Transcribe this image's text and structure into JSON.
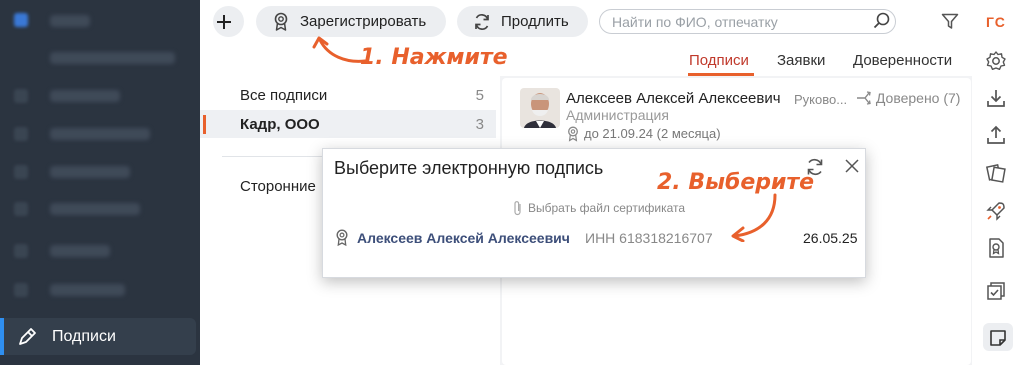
{
  "toolbar": {
    "register_label": "Зарегистрировать",
    "extend_label": "Продлить",
    "search_placeholder": "Найти по ФИО, отпечатку"
  },
  "rail": {
    "gc_label": "ГС"
  },
  "tabs": [
    {
      "label": "Подписи",
      "active": true
    },
    {
      "label": "Заявки",
      "active": false
    },
    {
      "label": "Доверенности",
      "active": false
    }
  ],
  "annotations": {
    "step1": "1. Нажмите",
    "step2": "2. Выберите",
    "color": "#e8602c"
  },
  "sidebar": {
    "active_label": "Подписи",
    "bg_color": "#2b3440"
  },
  "filter_list": {
    "items": [
      {
        "label": "Все подписи",
        "count": "5"
      },
      {
        "label": "Кадр, ООО",
        "count": "3",
        "selected": true
      },
      {
        "label": "Сторонние",
        "count": ""
      }
    ]
  },
  "signature": {
    "name": "Алексеев Алексей Алексеевич",
    "role": "Руково...",
    "department": "Администрация",
    "valid_until": "до 21.09.24 (2 месяца)",
    "trusted": "Доверено (7)"
  },
  "modal": {
    "title": "Выберите электронную подпись",
    "select_file": "Выбрать файл сертификата",
    "cert_name": "Алексеев Алексей Алексеевич",
    "cert_inn": "ИНН 618318216707",
    "cert_date": "26.05.25"
  }
}
